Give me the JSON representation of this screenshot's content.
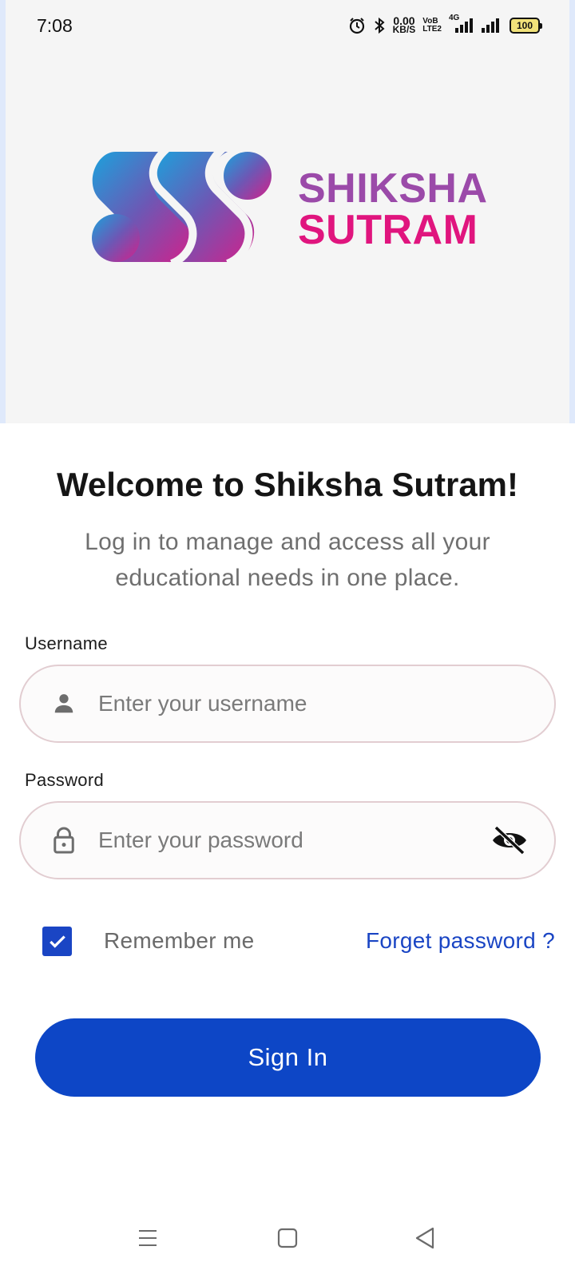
{
  "status_bar": {
    "time": "7:08",
    "net_speed_value": "0.00",
    "net_speed_unit": "KB/S",
    "volte_top": "VoB",
    "volte_bottom": "LTE2",
    "network_type": "4G",
    "battery_level": "100",
    "icons": [
      "alarm-icon",
      "bluetooth-icon",
      "signal-icon",
      "signal-icon",
      "battery-icon"
    ]
  },
  "brand": {
    "line1": "SHIKSHA",
    "line2": "SUTRAM",
    "color_purple": "#9b4aa9",
    "color_pink": "#e0157e",
    "color_blue": "#1ba2dc"
  },
  "welcome": {
    "title": "Welcome to Shiksha Sutram!",
    "subtitle": "Log in to manage and access all your educational needs in one place."
  },
  "form": {
    "username_label": "Username",
    "username_placeholder": "Enter your username",
    "password_label": "Password",
    "password_placeholder": "Enter your password",
    "remember_me_label": "Remember me",
    "remember_me_checked": true,
    "forgot_password_label": "Forget password ?",
    "sign_in_label": "Sign In"
  },
  "colors": {
    "primary": "#0d46c6",
    "field_border": "#e2cdd1",
    "header_bg": "#f5f5f5"
  },
  "nav_bar": {
    "icons": [
      "menu-icon",
      "home-square-icon",
      "back-triangle-icon"
    ]
  }
}
